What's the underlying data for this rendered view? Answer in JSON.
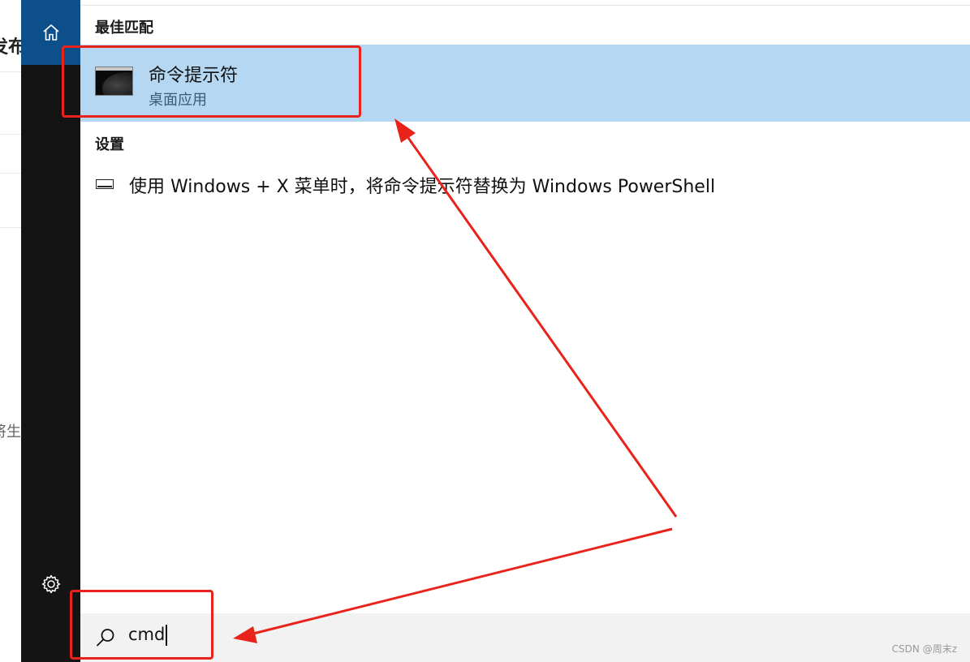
{
  "background": {
    "text_top": "发布",
    "text_mid": "将生"
  },
  "rail": {
    "home_icon": "home-icon",
    "settings_icon": "gear-icon"
  },
  "results": {
    "best_match_header": "最佳匹配",
    "best_match": {
      "name": "命令提示符",
      "type": "桌面应用",
      "icon": "terminal-icon"
    },
    "settings_header": "设置",
    "settings_items": [
      {
        "label": "使用 Windows + X 菜单时，将命令提示符替换为 Windows PowerShell",
        "icon": "display-icon"
      }
    ]
  },
  "search": {
    "value": "cmd",
    "icon": "search-icon"
  },
  "watermark": "CSDN @周末z",
  "colors": {
    "rail": "#141414",
    "home_active": "#0d4f8b",
    "selection": "#b5d7f1",
    "annotation": "#e8231b",
    "search_bar": "#f2f2f2"
  }
}
